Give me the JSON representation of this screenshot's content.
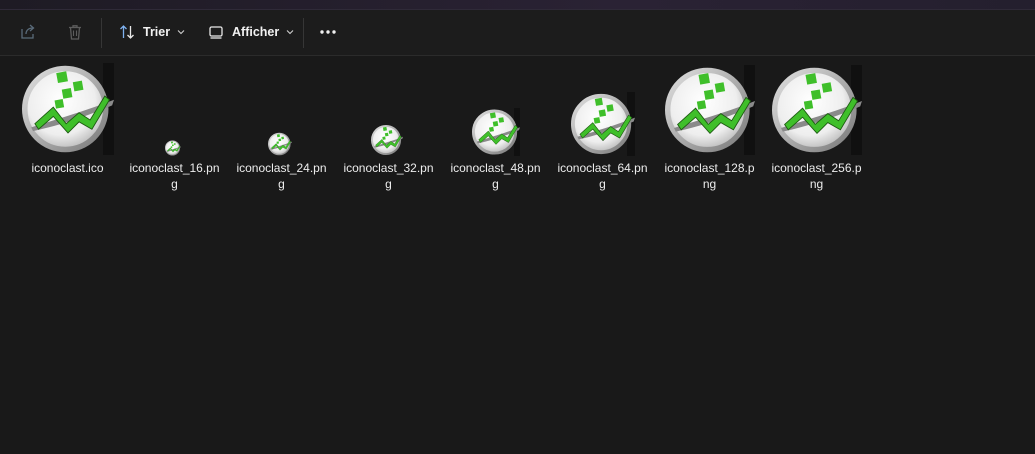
{
  "toolbar": {
    "share_icon": "share-icon",
    "delete_icon": "trash-icon",
    "sort_label": "Trier",
    "view_label": "Afficher",
    "more_icon": "more-icon"
  },
  "files": [
    {
      "name": "iconoclast.ico"
    },
    {
      "name": "iconoclast_16.png"
    },
    {
      "name": "iconoclast_24.png"
    },
    {
      "name": "iconoclast_32.png"
    },
    {
      "name": "iconoclast_48.png"
    },
    {
      "name": "iconoclast_64.png"
    },
    {
      "name": "iconoclast_128.png"
    },
    {
      "name": "iconoclast_256.png"
    }
  ],
  "colors": {
    "background": "#191919",
    "icon_green": "#3fbf2a",
    "icon_dark": "#1e5a12"
  }
}
